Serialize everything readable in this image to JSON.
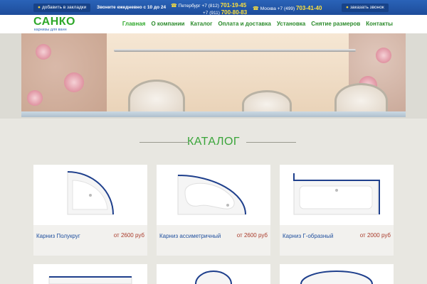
{
  "topbar": {
    "bookmark_label": "добавить в закладки",
    "hours_label": "Звоните ежедневно с 10 до 24",
    "spb_label": "Петербург +7 (812)",
    "spb_phone1": "701-19-45",
    "spb_prefix2": "+7 (911)",
    "spb_phone2": "700-80-83",
    "msk_label": "Москва +7 (499)",
    "msk_phone": "703-41-40",
    "callback_label": "заказать звонок"
  },
  "header": {
    "logo": "САНКО",
    "logo_sub": "карнизы для ванн",
    "nav": [
      "Главная",
      "О компании",
      "Каталог",
      "Оплата и доставка",
      "Установка",
      "Снятие размеров",
      "Контакты"
    ]
  },
  "catalog": {
    "title": "КАТАЛОГ",
    "items": [
      {
        "name": "Карниз Полукруг",
        "price": "от 2600 руб"
      },
      {
        "name": "Карниз ассиметричный",
        "price": "от 2600 руб"
      },
      {
        "name": "Карниз Г-образный",
        "price": "от 2000 руб"
      }
    ]
  },
  "colors": {
    "accent_green": "#2ea82a",
    "topbar_blue": "#2a63b8",
    "price_red": "#a93a2a"
  }
}
